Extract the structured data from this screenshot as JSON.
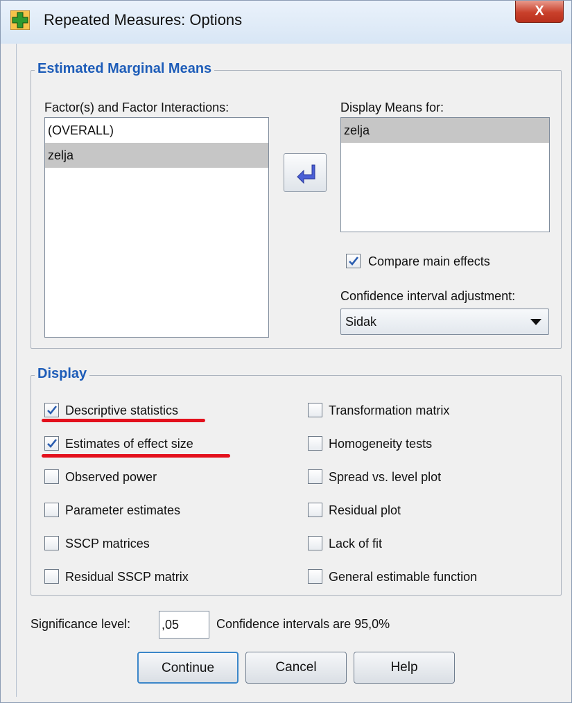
{
  "window": {
    "title": "Repeated Measures: Options",
    "close_glyph": "X"
  },
  "emm": {
    "legend": "Estimated Marginal Means",
    "factors_label": "Factor(s) and Factor Interactions:",
    "factors_items": [
      "(OVERALL)",
      "zelja"
    ],
    "display_label": "Display Means for:",
    "display_items": [
      "zelja"
    ],
    "compare_label": "Compare main effects",
    "compare_checked": true,
    "ci_label": "Confidence interval adjustment:",
    "ci_value": "Sidak"
  },
  "display": {
    "legend": "Display",
    "left": [
      {
        "label": "Descriptive statistics",
        "checked": true
      },
      {
        "label": "Estimates of effect size",
        "checked": true
      },
      {
        "label": "Observed power",
        "checked": false
      },
      {
        "label": "Parameter estimates",
        "checked": false
      },
      {
        "label": "SSCP matrices",
        "checked": false
      },
      {
        "label": "Residual SSCP matrix",
        "checked": false
      }
    ],
    "right": [
      {
        "label": "Transformation matrix",
        "checked": false
      },
      {
        "label": "Homogeneity tests",
        "checked": false
      },
      {
        "label": "Spread vs. level plot",
        "checked": false
      },
      {
        "label": "Residual plot",
        "checked": false
      },
      {
        "label": "Lack of fit",
        "checked": false
      },
      {
        "label": "General estimable function",
        "checked": false
      }
    ]
  },
  "footer": {
    "sig_label": "Significance level:",
    "sig_value": ",05",
    "ci_text": "Confidence intervals are 95,0%",
    "continue": "Continue",
    "cancel": "Cancel",
    "help": "Help"
  },
  "colors": {
    "legend": "#1d5cb8",
    "check": "#2a5db0",
    "annotation": "#e3101c",
    "selection": "#c6c6c6"
  },
  "icons": {
    "app": "spss-options-icon",
    "move": "move-left-arrow-icon",
    "dropdown": "chevron-down-icon"
  }
}
